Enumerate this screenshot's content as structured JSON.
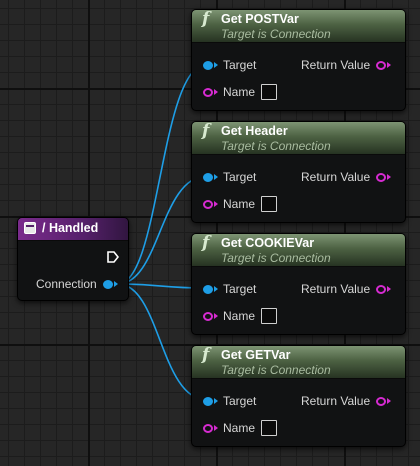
{
  "event_node": {
    "title": "/ Handled",
    "output_pin_label": "Connection",
    "header_color": "#55206a"
  },
  "function_nodes": [
    {
      "title": "Get POSTVar",
      "subtitle": "Target is Connection",
      "pins": {
        "target": "Target",
        "return": "Return Value",
        "name": "Name"
      }
    },
    {
      "title": "Get Header",
      "subtitle": "Target is Connection",
      "pins": {
        "target": "Target",
        "return": "Return Value",
        "name": "Name"
      }
    },
    {
      "title": "Get COOKIEVar",
      "subtitle": "Target is Connection",
      "pins": {
        "target": "Target",
        "return": "Return Value",
        "name": "Name"
      }
    },
    {
      "title": "Get GETVar",
      "subtitle": "Target is Connection",
      "pins": {
        "target": "Target",
        "return": "Return Value",
        "name": "Name"
      }
    }
  ],
  "colors": {
    "object_pin": "#1e9ee6",
    "string_pin": "#d62bd1",
    "function_header": "#4d6243",
    "background": "#262626"
  },
  "icons": {
    "function": "f-function-icon",
    "event": "event-icon",
    "exec": "exec-output-icon"
  }
}
